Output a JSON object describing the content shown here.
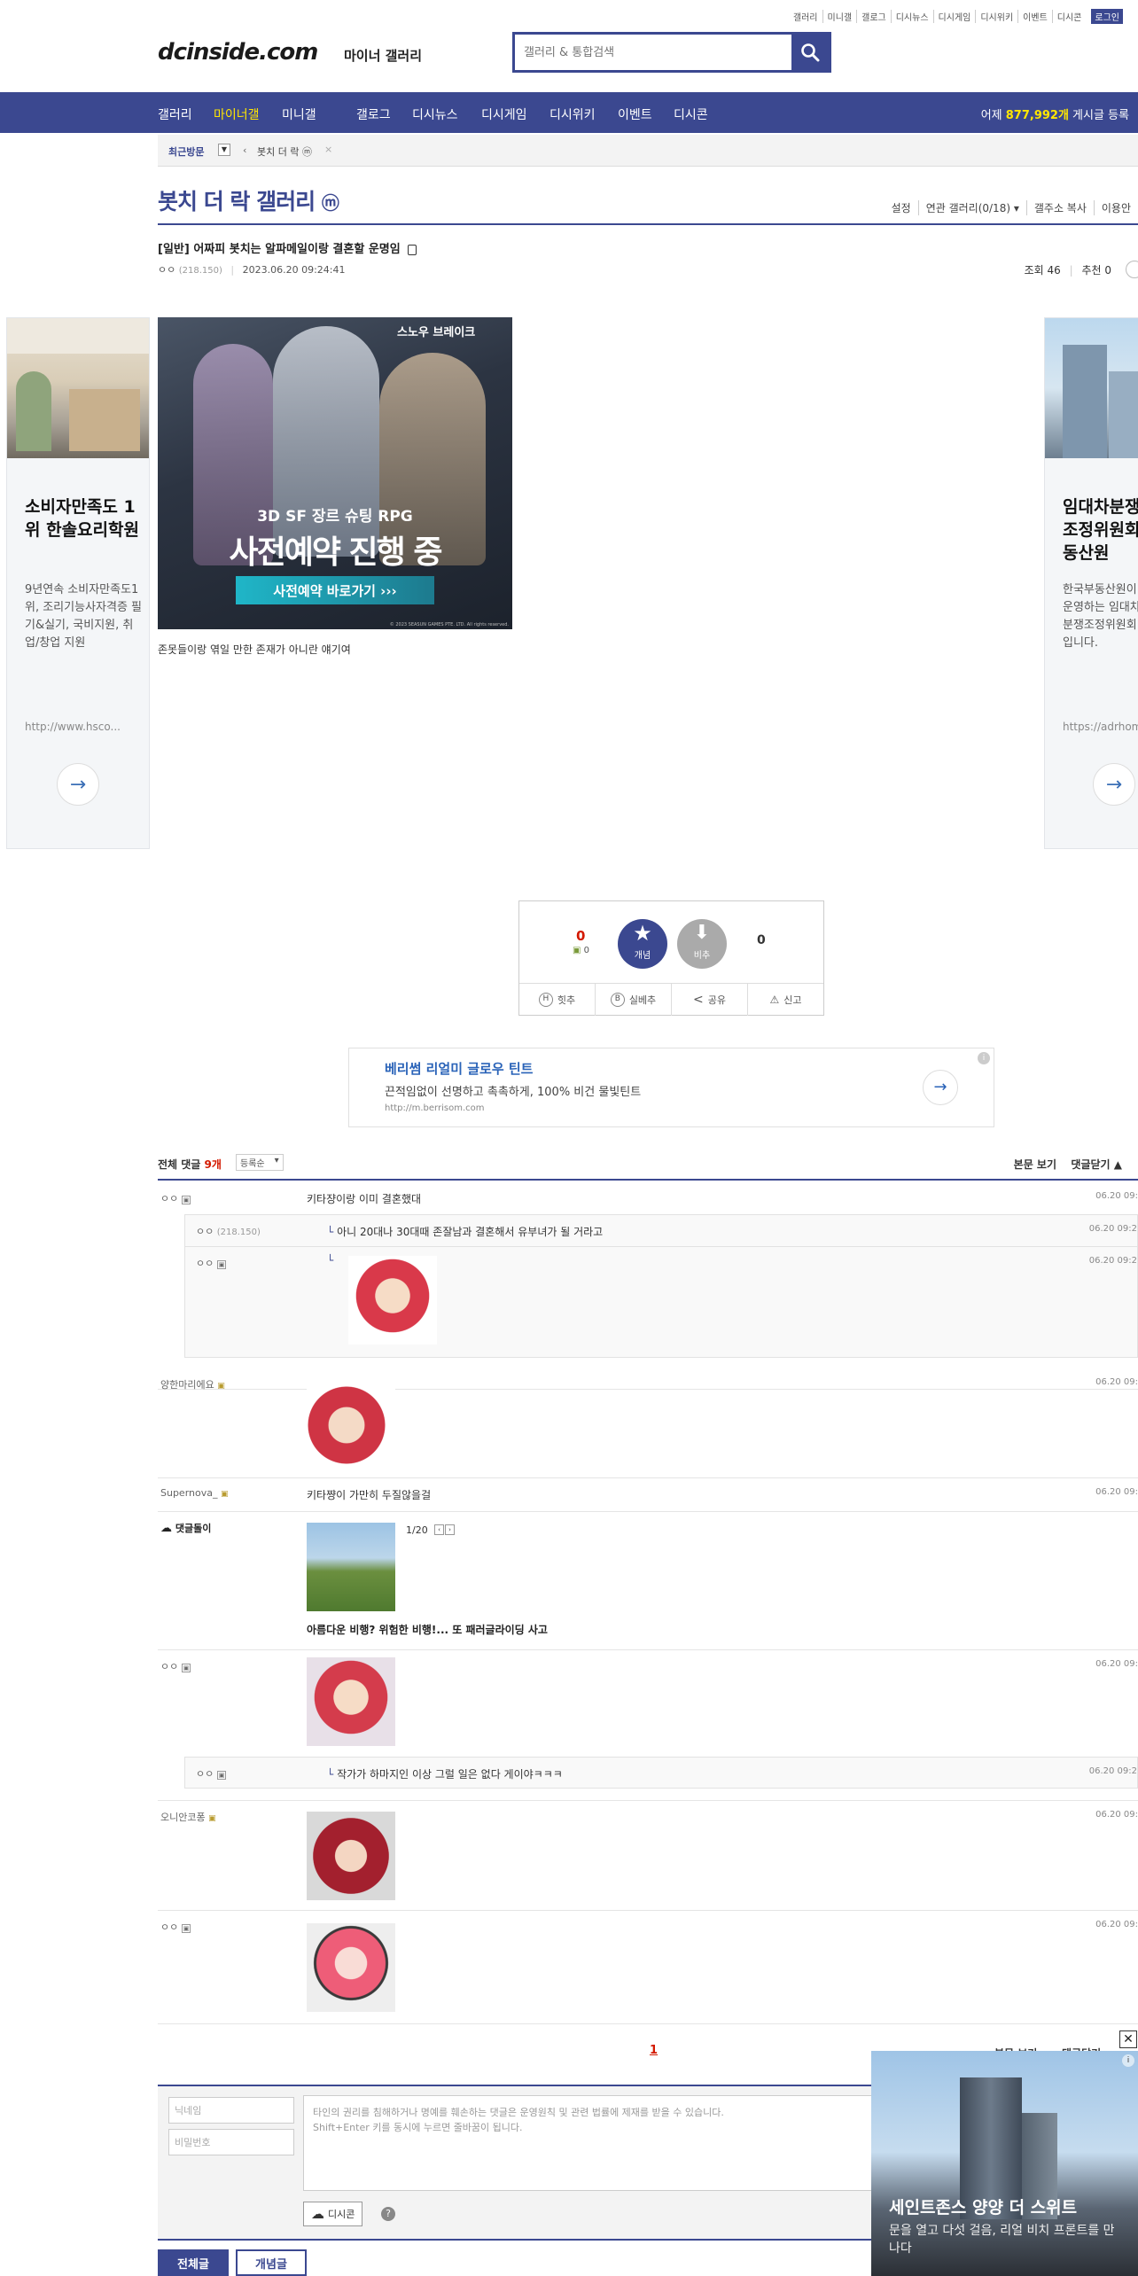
{
  "util_links": [
    "갤러리",
    "미니갤",
    "갤로그",
    "디시뉴스",
    "디시게임",
    "디시위키",
    "이벤트",
    "디시콘"
  ],
  "login": "로그인",
  "logo": "dcinside.com",
  "logo_sub": "마이너 갤러리",
  "search_placeholder": "갤러리 & 통합검색",
  "gnb": [
    "갤러리",
    "마이너갤",
    "미니갤",
    "갤로그",
    "디시뉴스",
    "디시게임",
    "디시위키",
    "이벤트",
    "디시콘"
  ],
  "gnb_stat": {
    "pre": "어제 ",
    "count": "877,992개",
    "post": " 게시글 등록"
  },
  "recent": {
    "label": "최근방문",
    "item": "봇치 더 락 ⓜ",
    "close": "×"
  },
  "gallery_title": "봇치 더 락 갤러리",
  "gallery_badge": "ⓜ",
  "gallery_opts": [
    "설정",
    "연관 갤러리(0/18) ▾",
    "갤주소 복사",
    "이용안"
  ],
  "post": {
    "title": "[일반] 어짜피 봇치는 알파메일이랑 결혼할 운명임",
    "author": "ㅇㅇ",
    "ip": "(218.150)",
    "date": "2023.06.20 09:24:41",
    "views": "조회 46",
    "recommend": "추천 0",
    "body": "존못들이랑 엮일 만한 존재가 아니란 얘기여"
  },
  "ad_image": {
    "brand": "스노우 브레이크",
    "line1": "3D SF 장르 슈팅 RPG",
    "line2": "사전예약 진행 중",
    "button": "사전예약 바로가기 ›››",
    "copyright": "© 2023 SEASUN GAMES PTE. LTD. All rights reserved."
  },
  "left_ad": {
    "title": "소비자만족도 1위 한솔요리학원",
    "desc": "9년연속 소비자만족도1위, 조리기능사자격증 필기&실기, 국비지원, 취업/창업 지원",
    "url": "http://www.hsco...",
    "arrow": "→"
  },
  "right_ad": {
    "title": "임대차분쟁조정위원회 동산원",
    "desc": "한국부동산원이 운영하는 임대차분쟁조정위원회입니다.",
    "url": "https://adrhome",
    "arrow": "→"
  },
  "vote": {
    "up": "0",
    "fixed": "0",
    "up_label": "개념",
    "down_label": "비추",
    "down": "0",
    "actions": [
      "힛추",
      "실베추",
      "공유",
      "신고"
    ]
  },
  "text_banner": {
    "title": "베리썸 리얼미 글로우 틴트",
    "desc": "끈적임없이 선명하고 촉촉하게, 100% 비건 물빛틴트",
    "url": "http://m.berrisom.com",
    "arrow": "→"
  },
  "comments_head": {
    "label": "전체 댓글 ",
    "count": "9개",
    "sort": "등록순",
    "view_body": "본문 보기",
    "close": "댓글닫기 ▲"
  },
  "comments": [
    {
      "name": "ㅇㅇ",
      "text": "키타쟝이랑 이미 결혼했대",
      "date": "06.20 09:"
    },
    {
      "name": "ㅇㅇ",
      "ip": "(218.150)",
      "text": "아니 20대나 30대때 존잘남과 결혼해서 유부녀가 될 거라고",
      "date": "06.20 09:2"
    },
    {
      "name": "ㅇㅇ",
      "date": "06.20 09:2"
    },
    {
      "name": "양한마리에요",
      "date": "06.20 09:"
    },
    {
      "name": "Supernova_",
      "text": "키타쨩이 가만히 두질않을걸",
      "date": "06.20 09:"
    },
    {
      "name": "댓글돌이",
      "counter": "1/20",
      "caption": "아름다운 비행? 위험한 비행!... 또 패러글라이딩 사고"
    },
    {
      "name": "ㅇㅇ",
      "date": "06.20 09:"
    },
    {
      "name": "ㅇㅇ",
      "text": "작가가 하마지인 이상 그럴 일은 없다 게이야ㅋㅋㅋ",
      "date": "06.20 09:2"
    },
    {
      "name": "오니안코퐁",
      "date": "06.20 09:"
    },
    {
      "name": "ㅇㅇ",
      "date": "06.20 09:"
    }
  ],
  "pagination": "1",
  "bottom_links": [
    "본문 보기",
    "댓글닫기"
  ],
  "write": {
    "nick": "닉네임",
    "pw": "비밀번호",
    "notice1": "타인의 권리를 침해하거나 명예를 훼손하는 댓글은 운영원칙 및 관련 법률에 제재를 받을 수 있습니다.",
    "notice2": "Shift+Enter 키를 동시에 누르면 줄바꿈이 됩니다.",
    "dccon": "디시콘",
    "help": "?"
  },
  "tabs": [
    "전체글",
    "개념글"
  ],
  "popup_ad": {
    "title": "세인트존스 양양 더 스위트",
    "desc": "문을 열고 다섯 걸음, 리얼 비치 프론트를 만나다",
    "close": "✕",
    "info": "i"
  },
  "colors": {
    "brand": "#3b4890",
    "accent": "#ffe600",
    "red": "#d31900"
  }
}
